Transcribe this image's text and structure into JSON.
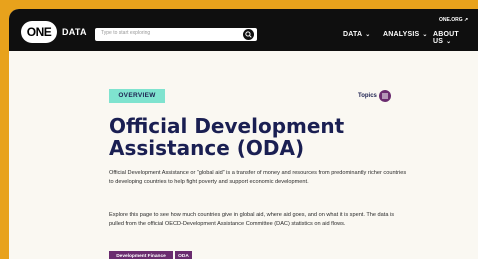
{
  "header": {
    "logo_text": "ONE",
    "logo_suffix": "DATA",
    "search_placeholder": "Type to start exploring",
    "top_link": "ONE.ORG",
    "nav": [
      {
        "label": "DATA"
      },
      {
        "label": "ANALYSIS"
      },
      {
        "label": "ABOUT US"
      }
    ]
  },
  "main": {
    "badge": "OVERVIEW",
    "topics_label": "Topics",
    "title": "Official Development Assistance (ODA)",
    "paragraphs": [
      "Official Development Assistance or “global aid” is a transfer of money and resources from predominantly richer countries to developing countries to help fight poverty and support economic development.",
      "Explore this page to see how much countries give in global aid, where aid goes, and on what it is spent. The data is pulled from the official OECD-Development Assistance Committee (DAC) statistics on aid flows."
    ],
    "tags": [
      "Development Finance",
      "ODA"
    ]
  },
  "colors": {
    "frame_border": "#e8a21c",
    "header_bg": "#0f0f0f",
    "badge_bg": "#7fe3cf",
    "title_color": "#1a1f52",
    "tag_bg": "#6a2c6f"
  }
}
